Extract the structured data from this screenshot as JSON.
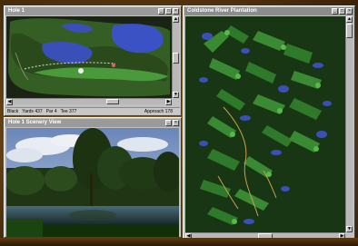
{
  "windows": {
    "hole_view": {
      "title": "Hole 1",
      "status": {
        "player": "Black",
        "yards": "Yards 437",
        "par": "Par 4",
        "tee": "Tee 377",
        "approach": "Approach 178"
      }
    },
    "scenery_view": {
      "title": "Hole 1 Scenery View"
    },
    "course_map": {
      "title": "Coldstone River Plantation"
    }
  },
  "title_buttons": {
    "minimize": "_",
    "maximize": "□",
    "close": "×"
  },
  "scroll_arrows": {
    "up": "▲",
    "down": "▼",
    "left": "◀",
    "right": "▶"
  },
  "colors": {
    "window_chrome": "#c0c0c0",
    "fairway": "#2f7a2a",
    "water": "#3b4fb8",
    "rough": "#1a3f18",
    "path": "#c8a050"
  }
}
